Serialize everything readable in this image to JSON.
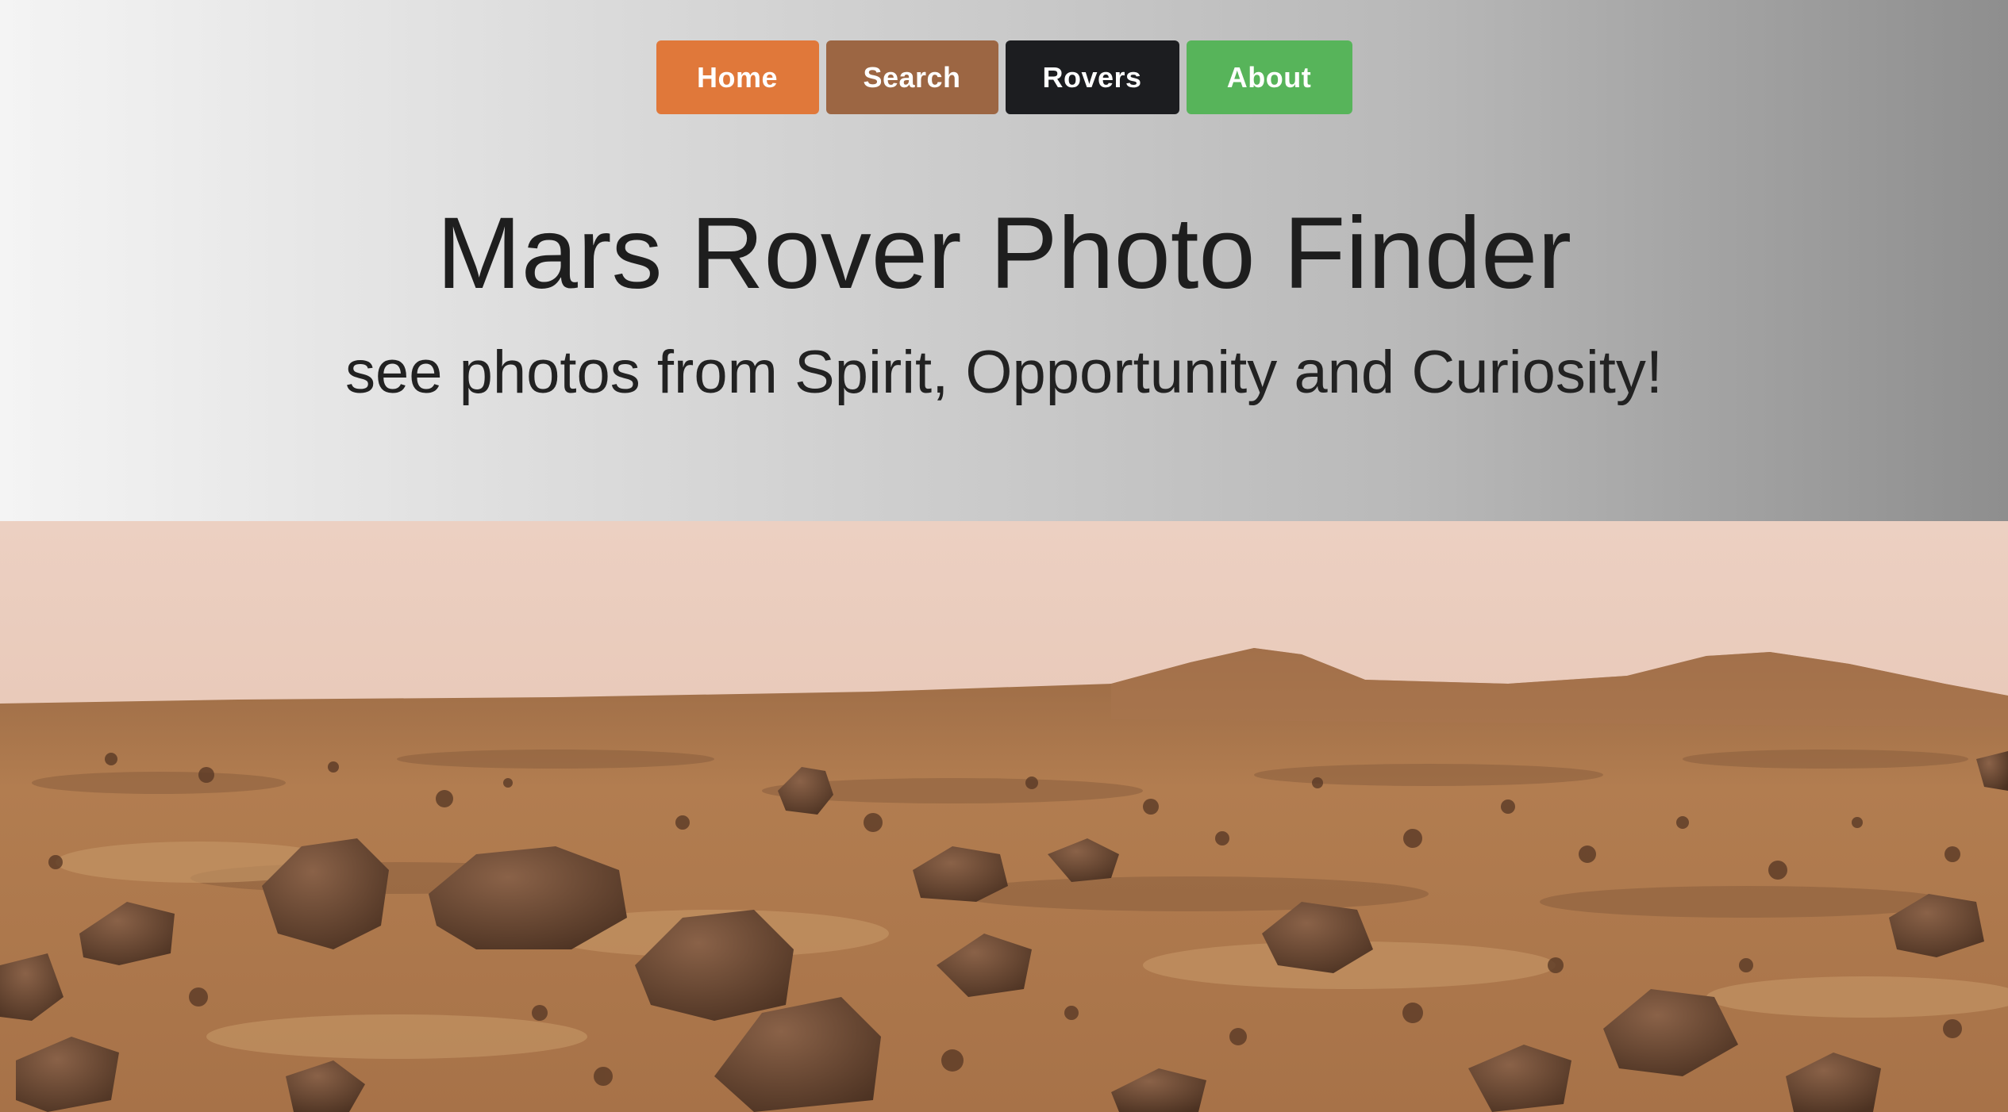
{
  "nav": {
    "items": [
      {
        "label": "Home",
        "color": "#e0783a"
      },
      {
        "label": "Search",
        "color": "#9c6643"
      },
      {
        "label": "Rovers",
        "color": "#1c1d20"
      },
      {
        "label": "About",
        "color": "#57b45a"
      }
    ]
  },
  "hero": {
    "title": "Mars Rover Photo Finder",
    "subtitle": "see photos from Spirit, Opportunity and Curiosity!"
  },
  "colors": {
    "sky": "#e6c4b4",
    "ground": "#b07a4c",
    "rock": "#6e4a32"
  }
}
